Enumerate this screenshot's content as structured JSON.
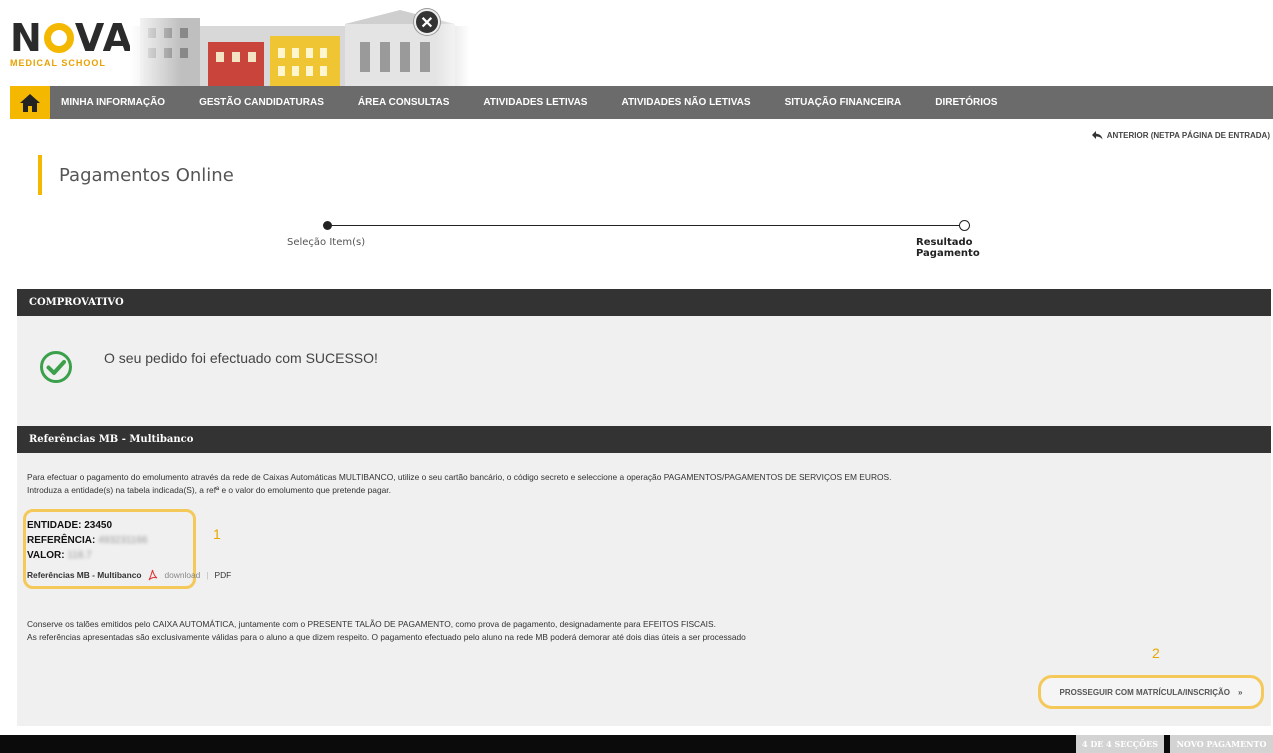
{
  "brand": {
    "logo_main_left": "N",
    "logo_main_right": "VA",
    "logo_sub": "MEDICAL SCHOOL",
    "close_glyph": "✕",
    "accent": "#f5b800"
  },
  "nav": {
    "home_icon": "home-icon",
    "items": [
      {
        "label": "MINHA INFORMAÇÃO"
      },
      {
        "label": "GESTÃO CANDIDATURAS"
      },
      {
        "label": "ÁREA CONSULTAS"
      },
      {
        "label": "ATIVIDADES LETIVAS"
      },
      {
        "label": "ATIVIDADES NÃO LETIVAS"
      },
      {
        "label": "SITUAÇÃO FINANCEIRA"
      },
      {
        "label": "DIRETÓRIOS"
      }
    ]
  },
  "back_link": {
    "label": "ANTERIOR (NETPA PÁGINA DE ENTRADA)",
    "icon": "back-arrow-icon"
  },
  "page": {
    "title": "Pagamentos Online"
  },
  "stepper": {
    "step1": "Seleção Item(s)",
    "step2": "Resultado Pagamento"
  },
  "comprovativo": {
    "header": "COMPROVATIVO",
    "message": "O seu pedido foi efectuado com SUCESSO!",
    "icon": "check-circle-icon"
  },
  "mb": {
    "header": "Referências MB - Multibanco",
    "intro_line1": "Para efectuar o pagamento do emolumento através da rede de Caixas Automáticas MULTIBANCO, utilize o seu cartão bancário, o código secreto e seleccione a operação PAGAMENTOS/PAGAMENTOS DE SERVIÇOS EM EUROS.",
    "intro_line2": "Introduza a entidade(s) na tabela indicada(S), a refª e o valor do emolumento que pretende pagar.",
    "entidade_label": "ENTIDADE:",
    "entidade_value": "23450",
    "referencia_label": "REFERÊNCIA:",
    "referencia_value": "493231166",
    "valor_label": "VALOR:",
    "valor_value": "118.7",
    "annotation_1": "1",
    "link_label": "Referências MB - Multibanco",
    "download_label": "download",
    "separator": "|",
    "pdf_label": "PDF",
    "note_line1": "Conserve os talões emitidos pelo CAIXA AUTOMÁTICA, juntamente com o PRESENTE TALÃO DE PAGAMENTO, como prova de pagamento, designadamente para EFEITOS FISCAIS.",
    "note_line2": "As referências apresentadas são exclusivamente válidas para o aluno a que dizem respeito. O pagamento efectuado pelo aluno na rede MB poderá demorar até dois dias úteis a ser processado",
    "annotation_2": "2",
    "proceed_label": "PROSSEGUIR COM MATRÍCULA/INSCRIÇÃO",
    "proceed_glyph": "»"
  },
  "footer": {
    "sections": "4 DE 4 SECÇÕES",
    "new_payment": "NOVO PAGAMENTO"
  }
}
